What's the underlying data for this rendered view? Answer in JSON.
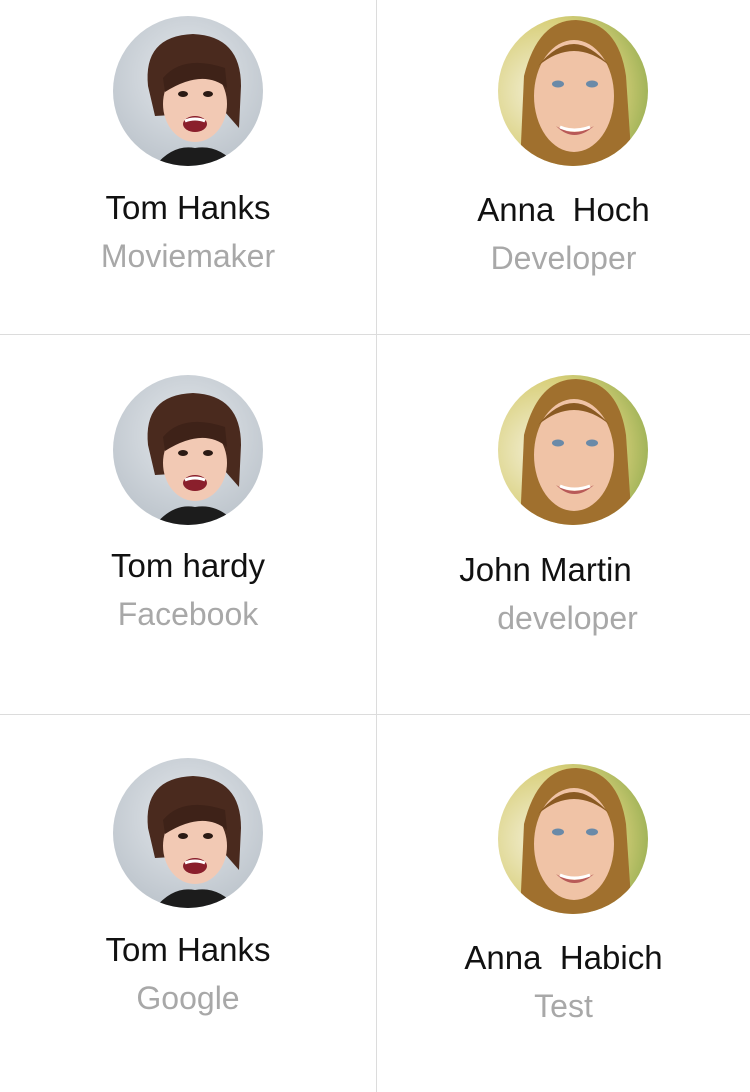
{
  "contacts": [
    {
      "name": "Tom Hanks",
      "role": "Moviemaker",
      "avatar": "woman-dark-hair-avatar"
    },
    {
      "name": "Anna  Hoch",
      "role": "Developer",
      "avatar": "woman-red-hair-avatar"
    },
    {
      "name": "Tom hardy",
      "role": "Facebook",
      "avatar": "woman-dark-hair-avatar"
    },
    {
      "name": "John Martin",
      "role": "developer",
      "avatar": "woman-red-hair-avatar"
    },
    {
      "name": "Tom Hanks",
      "role": "Google",
      "avatar": "woman-dark-hair-avatar"
    },
    {
      "name": "Anna  Habich",
      "role": "Test",
      "avatar": "woman-red-hair-avatar"
    }
  ],
  "colors": {
    "name_text": "#111111",
    "role_text": "#a8a8a8",
    "divider": "#dcdcdc"
  }
}
